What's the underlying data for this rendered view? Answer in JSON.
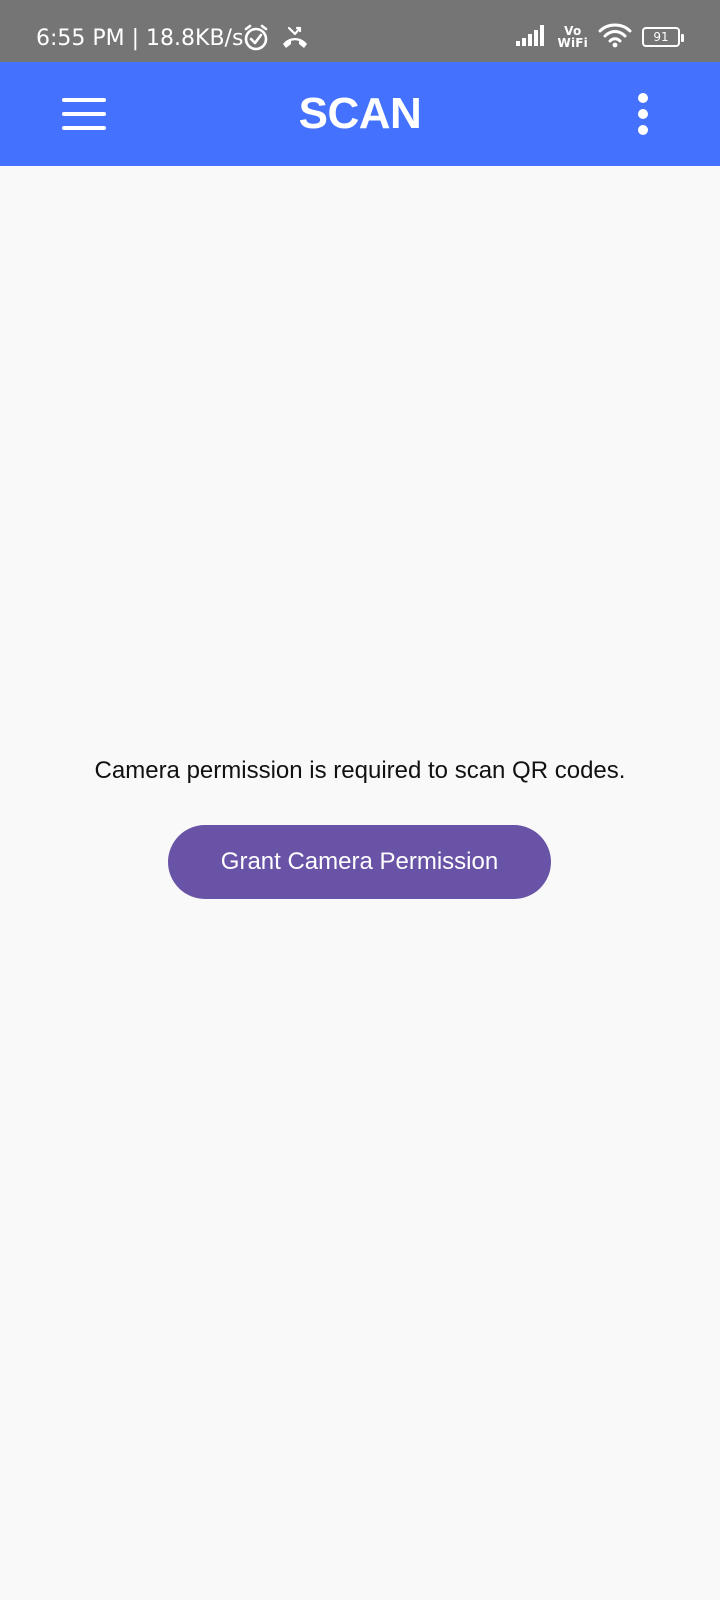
{
  "status_bar": {
    "time_speed": "6:55 PM | 18.8KB/s",
    "icons": [
      "alarm-icon",
      "missed-call-icon",
      "signal-icon",
      "wifi-icon"
    ],
    "vo_label": "Vo",
    "wifi_label": "WiFi",
    "battery_level": "91"
  },
  "app_bar": {
    "title": "SCAN",
    "background_color": "#4472ff",
    "menu_icon": "hamburger-menu-icon",
    "more_icon": "more-vertical-icon"
  },
  "main": {
    "permission_message": "Camera permission is required to scan QR codes.",
    "grant_button_label": "Grant Camera Permission",
    "button_color": "#6953a7"
  }
}
